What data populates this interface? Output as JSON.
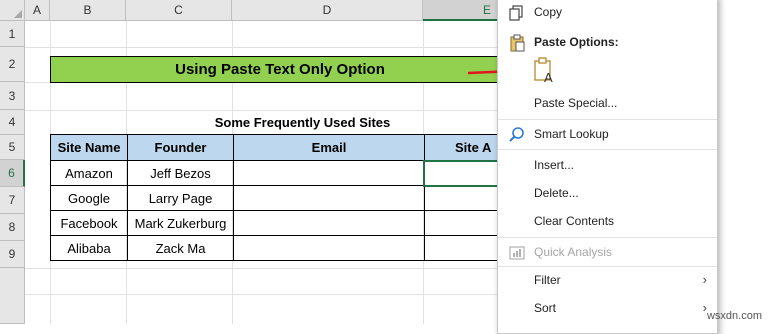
{
  "columns": [
    "A",
    "B",
    "C",
    "D",
    "E"
  ],
  "rows": [
    "1",
    "2",
    "3",
    "4",
    "5",
    "6",
    "7",
    "8",
    "9"
  ],
  "title_text": "Using Paste Text Only  Option",
  "table_title": "Some Frequently Used Sites",
  "headers": [
    "Site Name",
    "Founder",
    "Email",
    "Site A"
  ],
  "table_rows": [
    [
      "Amazon",
      "Jeff Bezos",
      "",
      ""
    ],
    [
      "Google",
      "Larry Page",
      "",
      ""
    ],
    [
      "Facebook",
      "Mark Zukerburg",
      "",
      ""
    ],
    [
      "Alibaba",
      "Zack Ma",
      "",
      ""
    ]
  ],
  "context_menu": {
    "copy": "Copy",
    "paste_options": "Paste Options:",
    "paste_special": "Paste Special...",
    "smart_lookup": "Smart Lookup",
    "insert": "Insert...",
    "delete": "Delete...",
    "clear_contents": "Clear Contents",
    "quick_analysis": "Quick Analysis",
    "filter": "Filter",
    "sort": "Sort"
  },
  "icons": {
    "copy": "copy-icon",
    "paste": "paste-icon",
    "paste_text_only": "paste-text-only-icon",
    "smart_lookup": "search-icon",
    "quick_analysis": "quick-analysis-icon",
    "submenu": "chevron-right-icon"
  },
  "colors": {
    "title_band": "#92d050",
    "header_fill": "#bdd7ee",
    "selection": "#217346",
    "arrow": "#e0161b"
  },
  "watermark": "wsxdn.com"
}
